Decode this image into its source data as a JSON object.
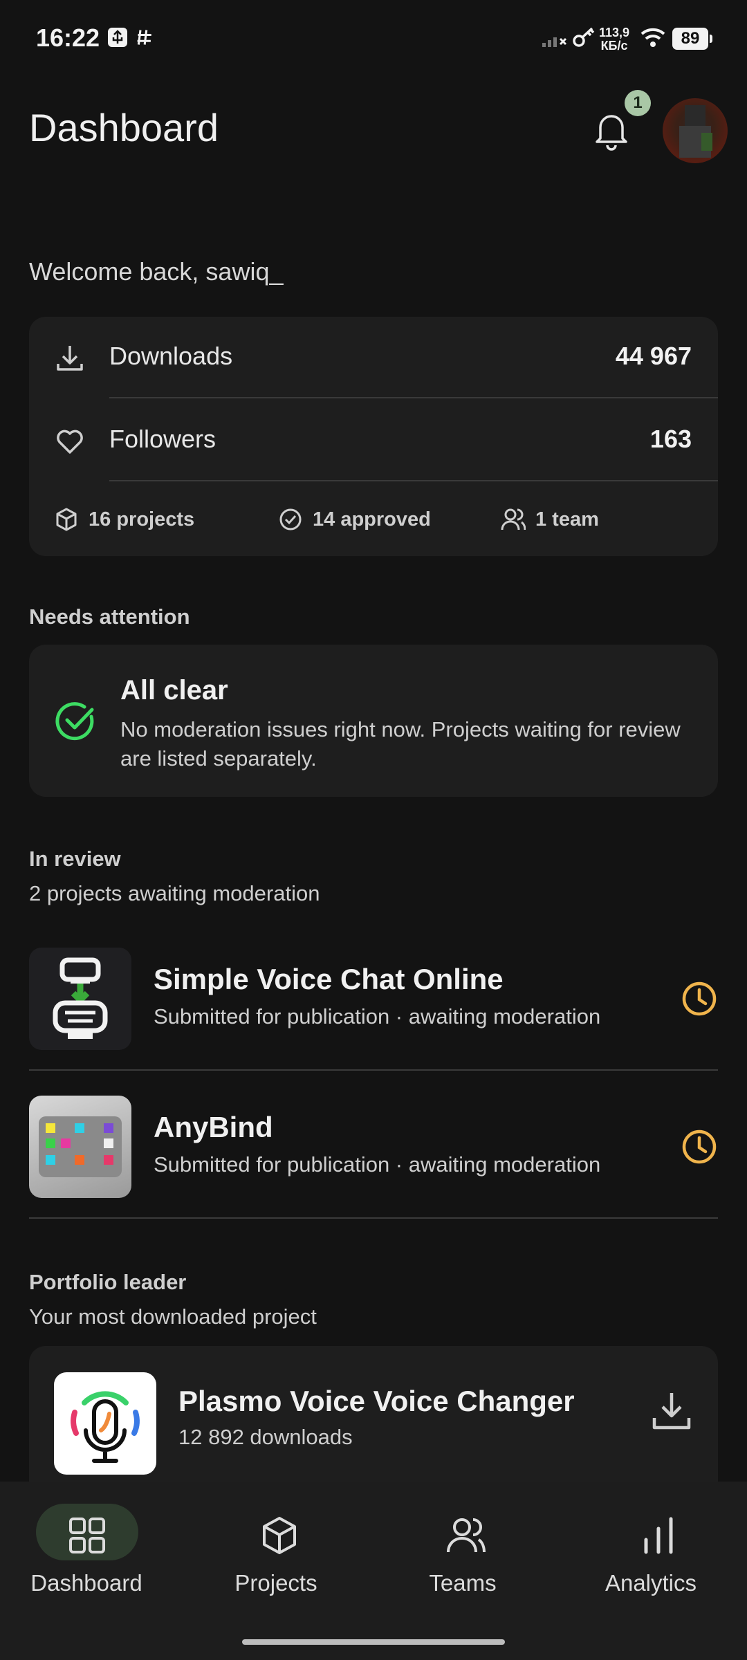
{
  "status_bar": {
    "time": "16:22",
    "net_speed_value": "113,9",
    "net_speed_unit": "КБ/с",
    "battery": "89"
  },
  "header": {
    "title": "Dashboard",
    "notification_count": "1"
  },
  "welcome": "Welcome back, sawiq_",
  "stats": {
    "downloads_label": "Downloads",
    "downloads_value": "44 967",
    "followers_label": "Followers",
    "followers_value": "163",
    "projects": "16 projects",
    "approved": "14 approved",
    "team": "1 team"
  },
  "attention": {
    "section_title": "Needs attention",
    "title": "All clear",
    "text": "No moderation issues right now. Projects waiting for review are listed separately."
  },
  "review": {
    "section_title": "In review",
    "subtitle": "2 projects awaiting moderation",
    "items": [
      {
        "name": "Simple Voice Chat Online",
        "status": "Submitted for publication · awaiting moderation"
      },
      {
        "name": "AnyBind",
        "status": "Submitted for publication · awaiting moderation"
      }
    ]
  },
  "leader": {
    "section_title": "Portfolio leader",
    "subtitle": "Your most downloaded project",
    "name": "Plasmo Voice Voice Changer",
    "downloads": "12 892 downloads"
  },
  "nav": {
    "items": [
      {
        "label": "Dashboard",
        "icon": "grid-icon",
        "active": true
      },
      {
        "label": "Projects",
        "icon": "box-icon",
        "active": false
      },
      {
        "label": "Teams",
        "icon": "users-icon",
        "active": false
      },
      {
        "label": "Analytics",
        "icon": "bar-chart-icon",
        "active": false
      }
    ]
  },
  "colors": {
    "background": "#131313",
    "card": "#1e1e1e",
    "success": "#3ddc63",
    "pending": "#f0b44c",
    "nav_active": "#2e3c2e",
    "badge": "#a9c7a6"
  }
}
